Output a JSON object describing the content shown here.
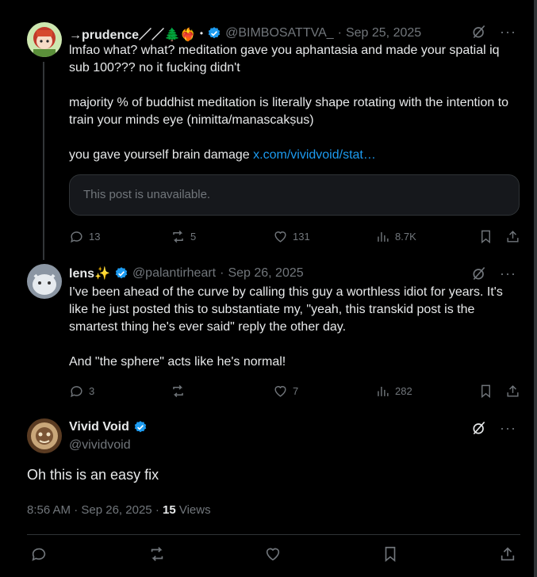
{
  "post1": {
    "name": "→prudence／／🌲❤️‍🔥",
    "name_sep": "•",
    "handle": "@BIMBOSATTVA_",
    "date_sep": "·",
    "date": "Sep 25, 2025",
    "paragraphs": [
      "lmfao what? what? meditation gave you aphantasia and made your spatial iq sub 100??? no it fucking didn't",
      "majority % of buddhist meditation is literally shape rotating with the intention to train your minds eye (nimitta/manascakṣus)"
    ],
    "last_line_text": "you gave yourself brain damage ",
    "link_text": "x.com/vividvoid/stat…",
    "quote_text": "This post is unavailable.",
    "replies": "13",
    "reposts": "5",
    "likes": "131",
    "views": "8.7K"
  },
  "post2": {
    "name": "lens✨",
    "handle": "@palantirheart",
    "date_sep": "·",
    "date": "Sep 26, 2025",
    "paragraphs": [
      "I've been ahead of the curve by calling this guy a worthless idiot for years. It's like he just posted this to substantiate my, \"yeah, this transkid post is the smartest thing he's ever said\" reply the other day.",
      "And \"the sphere\" acts like he's normal!"
    ],
    "replies": "3",
    "reposts": "",
    "likes": "7",
    "views": "282"
  },
  "main_post": {
    "name": "Vivid Void",
    "handle": "@vividvoid",
    "text": "Oh this is an easy fix",
    "time": "8:56 AM",
    "date_sep": "·",
    "date": "Sep 26, 2025",
    "views_sep": "·",
    "views_count": "15",
    "views_label": "Views"
  },
  "colors": {
    "background": "#000000",
    "text": "#e7e9ea",
    "muted": "#71767b",
    "link": "#1d9bf0",
    "verified": "#1d9bf0"
  },
  "icons": [
    "grok-icon",
    "more-icon",
    "verified-badge-icon",
    "reply-icon",
    "repost-icon",
    "like-icon",
    "views-icon",
    "bookmark-icon",
    "share-icon"
  ]
}
